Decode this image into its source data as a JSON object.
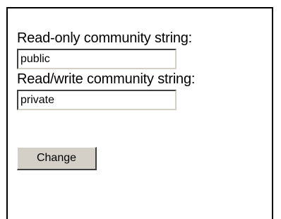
{
  "form": {
    "ro_label": "Read-only community string:",
    "ro_value": "public",
    "rw_label": "Read/write community string:",
    "rw_value": "private",
    "change_label": "Change"
  }
}
